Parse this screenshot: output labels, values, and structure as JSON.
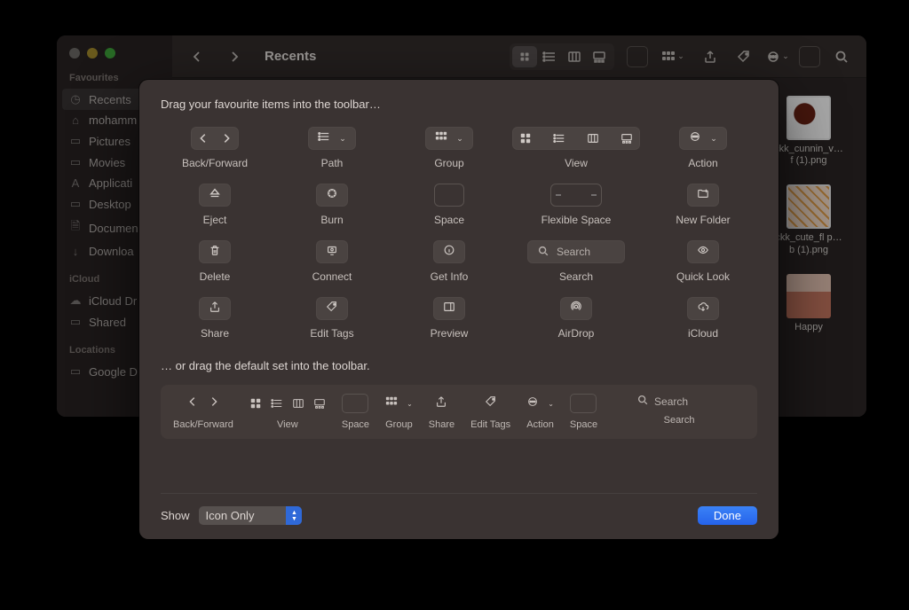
{
  "window": {
    "title": "Recents"
  },
  "sidebar": {
    "sections": {
      "favourites": "Favourites",
      "icloud": "iCloud",
      "locations": "Locations"
    },
    "items": [
      {
        "label": "Recents"
      },
      {
        "label": "mohamm"
      },
      {
        "label": "Pictures"
      },
      {
        "label": "Movies"
      },
      {
        "label": "Applicati"
      },
      {
        "label": "Desktop"
      },
      {
        "label": "Documen"
      },
      {
        "label": "Downloa"
      },
      {
        "label": "iCloud Dr"
      },
      {
        "label": "Shared"
      },
      {
        "label": "Google D"
      }
    ]
  },
  "files": [
    {
      "name": "ckk_cunnin_v…f (1).png"
    },
    {
      "name": "ckk_cute_fl p…b (1).png"
    },
    {
      "name": "Happy"
    }
  ],
  "sheet": {
    "instruction_top": "Drag your favourite items into the toolbar…",
    "instruction_default": "… or drag the default set into the toolbar.",
    "palette": [
      {
        "label": "Back/Forward"
      },
      {
        "label": "Path"
      },
      {
        "label": "Group"
      },
      {
        "label": "View"
      },
      {
        "label": "Action"
      },
      {
        "label": "Eject"
      },
      {
        "label": "Burn"
      },
      {
        "label": "Space"
      },
      {
        "label": "Flexible Space"
      },
      {
        "label": "New Folder"
      },
      {
        "label": "Delete"
      },
      {
        "label": "Connect"
      },
      {
        "label": "Get Info"
      },
      {
        "label": "Search",
        "placeholder": "Search"
      },
      {
        "label": "Quick Look"
      },
      {
        "label": "Share"
      },
      {
        "label": "Edit Tags"
      },
      {
        "label": "Preview"
      },
      {
        "label": "AirDrop"
      },
      {
        "label": "iCloud"
      }
    ],
    "default_set": [
      {
        "label": "Back/Forward"
      },
      {
        "label": "View"
      },
      {
        "label": "Space"
      },
      {
        "label": "Group"
      },
      {
        "label": "Share"
      },
      {
        "label": "Edit Tags"
      },
      {
        "label": "Action"
      },
      {
        "label": "Space"
      },
      {
        "label": "Search",
        "placeholder": "Search"
      }
    ],
    "show_label": "Show",
    "show_value": "Icon Only",
    "done": "Done"
  }
}
